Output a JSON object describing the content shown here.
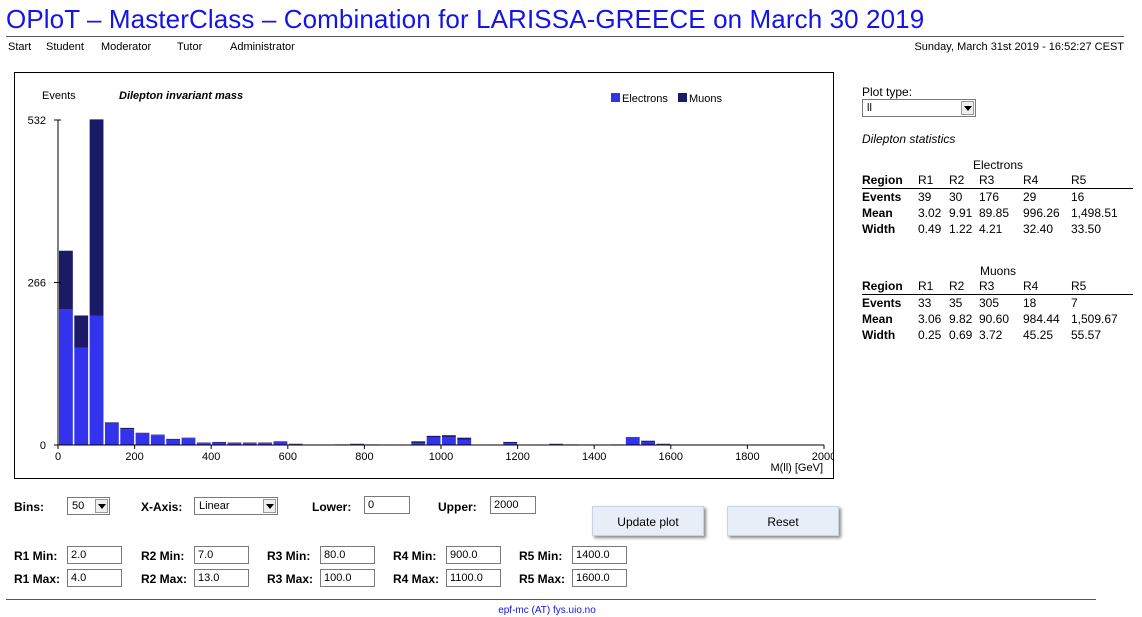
{
  "page": {
    "title": "OPloT – MasterClass – Combination for LARISSA-GREECE on March 30 2019",
    "datetime": "Sunday, March 31st 2019 - 16:52:27 CEST",
    "footer": "epf-mc (AT) fys.uio.no"
  },
  "nav": {
    "items": [
      "Start",
      "Student",
      "Moderator",
      "Tutor",
      "Administrator"
    ]
  },
  "colors": {
    "electrons": "#3333ee",
    "muons": "#1a1a66",
    "title": "#1414e6"
  },
  "chart_data": {
    "type": "bar",
    "stacked": true,
    "title": "Dilepton invariant mass",
    "ylabel": "Events",
    "xlabel": "M(ll) [GeV]",
    "xlim": [
      0,
      2000
    ],
    "ylim": [
      0,
      532
    ],
    "bin_width": 40,
    "x_ticks": [
      0,
      200,
      400,
      600,
      800,
      1000,
      1200,
      1400,
      1600,
      1800,
      2000
    ],
    "y_ticks": [
      0,
      266,
      532
    ],
    "legend": {
      "position": "top-right",
      "entries": [
        "Electrons",
        "Muons"
      ]
    },
    "series": [
      {
        "name": "Electrons",
        "values": [
          222,
          159,
          212,
          35,
          26,
          19,
          16,
          9,
          11,
          3,
          4,
          3,
          3,
          3,
          5,
          1,
          0,
          0,
          0,
          1,
          1,
          0,
          0,
          3,
          12,
          13,
          9,
          0,
          0,
          3,
          0,
          0,
          1,
          0,
          0,
          0,
          1,
          12,
          5,
          1,
          0,
          0,
          0,
          0,
          0,
          0,
          0,
          0,
          0,
          0
        ]
      },
      {
        "name": "Muons",
        "values": [
          96,
          53,
          321,
          2,
          2,
          1,
          1,
          1,
          1,
          1,
          1,
          1,
          1,
          1,
          1,
          1,
          0,
          0,
          1,
          1,
          0,
          0,
          0,
          3,
          3,
          3,
          3,
          0,
          0,
          2,
          0,
          0,
          1,
          1,
          0,
          0,
          0,
          1,
          2,
          1,
          0,
          0,
          0,
          0,
          0,
          0,
          0,
          0,
          0,
          0
        ]
      }
    ]
  },
  "controls": {
    "bins_label": "Bins:",
    "bins_value": "50",
    "xaxis_label": "X-Axis:",
    "xaxis_value": "Linear",
    "lower_label": "Lower:",
    "lower_value": "0",
    "upper_label": "Upper:",
    "upper_value": "2000",
    "update_button": "Update plot",
    "reset_button": "Reset",
    "regions": [
      {
        "min_label": "R1 Min:",
        "max_label": "R1 Max:",
        "min": "2.0",
        "max": "4.0"
      },
      {
        "min_label": "R2 Min:",
        "max_label": "R2 Max:",
        "min": "7.0",
        "max": "13.0"
      },
      {
        "min_label": "R3 Min:",
        "max_label": "R3 Max:",
        "min": "80.0",
        "max": "100.0"
      },
      {
        "min_label": "R4 Min:",
        "max_label": "R4 Max:",
        "min": "900.0",
        "max": "1100.0"
      },
      {
        "min_label": "R5 Min:",
        "max_label": "R5 Max:",
        "min": "1400.0",
        "max": "1600.0"
      }
    ]
  },
  "side": {
    "plot_type_label": "Plot type:",
    "plot_type_value": "ll",
    "stats_title": "Dilepton statistics",
    "electrons": {
      "title": "Electrons",
      "header": [
        "Region",
        "R1",
        "R2",
        "R3",
        "R4",
        "R5"
      ],
      "rows": [
        [
          "Events",
          "39",
          "30",
          "176",
          "29",
          "16"
        ],
        [
          "Mean",
          "3.02",
          "9.91",
          "89.85",
          "996.26",
          "1,498.51"
        ],
        [
          "Width",
          "0.49",
          "1.22",
          "4.21",
          "32.40",
          "33.50"
        ]
      ]
    },
    "muons": {
      "title": "Muons",
      "header": [
        "Region",
        "R1",
        "R2",
        "R3",
        "R4",
        "R5"
      ],
      "rows": [
        [
          "Events",
          "33",
          "35",
          "305",
          "18",
          "7"
        ],
        [
          "Mean",
          "3.06",
          "9.82",
          "90.60",
          "984.44",
          "1,509.67"
        ],
        [
          "Width",
          "0.25",
          "0.69",
          "3.72",
          "45.25",
          "55.57"
        ]
      ]
    }
  }
}
